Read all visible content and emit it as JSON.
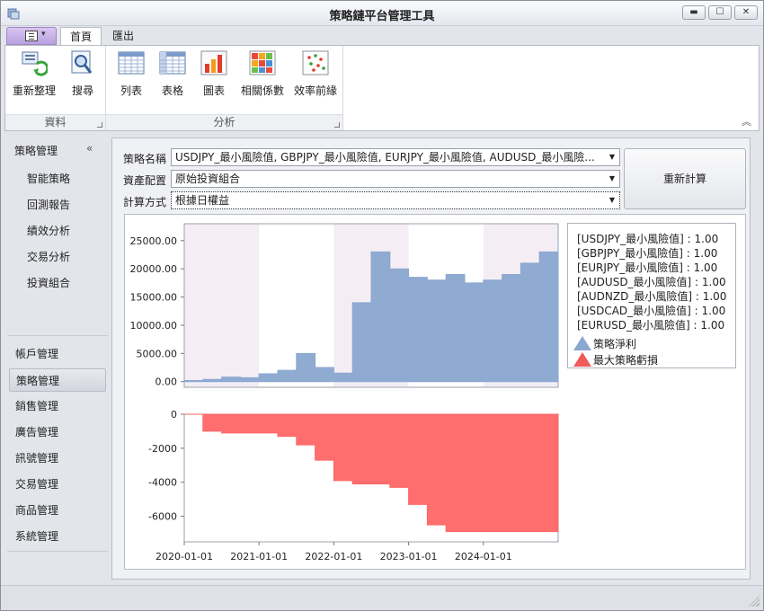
{
  "window": {
    "title": "策略鏈平台管理工具",
    "minimize": "▬",
    "maximize": "☐",
    "close": "✕"
  },
  "ribbon": {
    "tabs": [
      "首頁",
      "匯出"
    ],
    "active_tab": 0,
    "groups": [
      {
        "label": "資料",
        "buttons": [
          {
            "label": "重新整理",
            "icon": "refresh-icon"
          },
          {
            "label": "搜尋",
            "icon": "search-icon"
          }
        ]
      },
      {
        "label": "分析",
        "buttons": [
          {
            "label": "列表",
            "icon": "list-icon"
          },
          {
            "label": "表格",
            "icon": "table-icon"
          },
          {
            "label": "圖表",
            "icon": "bar-chart-icon"
          },
          {
            "label": "相關係數",
            "icon": "correlation-icon"
          },
          {
            "label": "效率前緣",
            "icon": "scatter-icon"
          }
        ]
      }
    ],
    "collapse_glyph": "︽"
  },
  "nav": {
    "header": "策略管理",
    "collapse_glyph": "«",
    "sub_items": [
      "智能策略",
      "回測報告",
      "績效分析",
      "交易分析",
      "投資組合"
    ],
    "main_items": [
      "帳戶管理",
      "策略管理",
      "銷售管理",
      "廣告管理",
      "訊號管理",
      "交易管理",
      "商品管理",
      "系統管理"
    ],
    "active_main": 1
  },
  "form": {
    "strategy_label": "策略名稱",
    "strategy_value": "USDJPY_最小風險值, GBPJPY_最小風險值, EURJPY_最小風險值, AUDUSD_最小風險...",
    "allocation_label": "資產配置",
    "allocation_value": "原始投資組合",
    "method_label": "計算方式",
    "method_value": "根據日權益",
    "recalc_button": "重新計算"
  },
  "legend": {
    "weights": [
      "[USDJPY_最小風險值] : 1.00",
      "[GBPJPY_最小風險值] : 1.00",
      "[EURJPY_最小風險值] : 1.00",
      "[AUDUSD_最小風險值] : 1.00",
      "[AUDNZD_最小風險值] : 1.00",
      "[USDCAD_最小風險值] : 1.00",
      "[EURUSD_最小風險值] : 1.00"
    ],
    "series": [
      {
        "name": "策略淨利",
        "color": "#8aa7d0"
      },
      {
        "name": "最大策略虧損",
        "color": "#f05a5a"
      }
    ]
  },
  "chart_data": [
    {
      "type": "area",
      "x": [
        "2020-01",
        "2020-04",
        "2020-07",
        "2020-10",
        "2021-01",
        "2021-04",
        "2021-07",
        "2021-10",
        "2022-01",
        "2022-04",
        "2022-07",
        "2022-10",
        "2023-01",
        "2023-04",
        "2023-07",
        "2023-10",
        "2024-01",
        "2024-04",
        "2024-07",
        "2024-10",
        "2024-12"
      ],
      "series": [
        {
          "name": "策略淨利",
          "values": [
            200,
            400,
            800,
            700,
            1400,
            2000,
            5000,
            2500,
            1500,
            14000,
            23000,
            20000,
            18500,
            18000,
            19000,
            17500,
            18000,
            19000,
            21000,
            23000,
            25500
          ]
        }
      ],
      "yticks": [
        "0.00",
        "5000.00",
        "10000.00",
        "15000.00",
        "20000.00",
        "25000.00"
      ],
      "ylim": [
        -1000,
        28000
      ],
      "color": "#8aa7d0"
    },
    {
      "type": "area",
      "x": [
        "2020-01",
        "2020-04",
        "2020-07",
        "2020-10",
        "2021-01",
        "2021-04",
        "2021-07",
        "2021-10",
        "2022-01",
        "2022-04",
        "2022-07",
        "2022-10",
        "2023-01",
        "2023-04",
        "2023-07",
        "2023-10",
        "2024-01",
        "2024-04",
        "2024-07",
        "2024-10",
        "2024-12"
      ],
      "series": [
        {
          "name": "最大策略虧損",
          "values": [
            0,
            -1000,
            -1100,
            -1100,
            -1100,
            -1300,
            -1800,
            -2700,
            -3900,
            -4100,
            -4100,
            -4300,
            -5300,
            -6500,
            -6900,
            -6900,
            -6900,
            -6900,
            -6900,
            -6900,
            -6900
          ]
        }
      ],
      "yticks": [
        "0",
        "-2000",
        "-4000",
        "-6000"
      ],
      "ylim": [
        -7500,
        0
      ],
      "color": "#ff6666"
    }
  ],
  "xaxis_ticks": [
    "2020-01-01",
    "2021-01-01",
    "2022-01-01",
    "2023-01-01",
    "2024-01-01"
  ]
}
